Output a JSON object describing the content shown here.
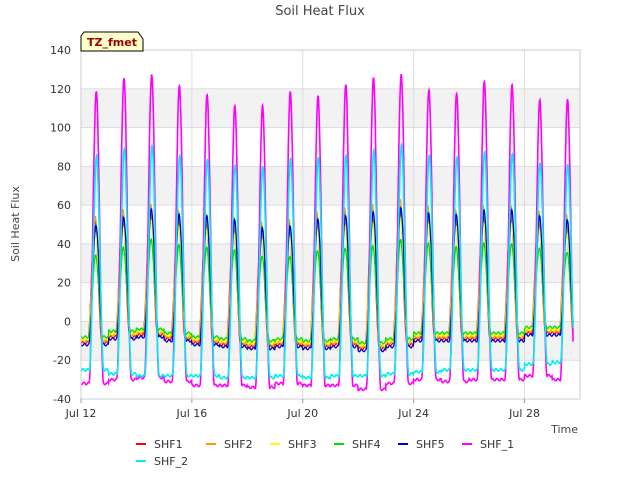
{
  "chart_data": {
    "type": "line",
    "title": "Soil Heat Flux",
    "xlabel": "Time",
    "ylabel": "Soil Heat Flux",
    "badge": "TZ_fmet",
    "x_range_days": [
      12.0,
      30.0
    ],
    "ylim": [
      -40,
      140
    ],
    "y_ticks": [
      -40,
      -20,
      0,
      20,
      40,
      60,
      80,
      100,
      120,
      140
    ],
    "x_ticks": [
      {
        "label": "Jul 12",
        "day": 12
      },
      {
        "label": "Jul 16",
        "day": 16
      },
      {
        "label": "Jul 20",
        "day": 20
      },
      {
        "label": "Jul 24",
        "day": 24
      },
      {
        "label": "Jul 28",
        "day": 28
      }
    ],
    "grid": true,
    "legend_position": "bottom",
    "series": [
      {
        "name": "SHF1",
        "color": "#ff0000",
        "peaks": [
          52,
          55,
          60,
          56,
          55,
          52,
          49,
          50,
          54,
          56,
          58,
          60,
          57,
          56,
          58,
          58,
          55,
          53
        ],
        "troughs": [
          -11,
          -8,
          -7,
          -9,
          -11,
          -12,
          -13,
          -12,
          -13,
          -12,
          -14,
          -12,
          -9,
          -9,
          -9,
          -9,
          -6,
          -6
        ]
      },
      {
        "name": "SHF2",
        "color": "#ff9900",
        "peaks": [
          54,
          58,
          61,
          58,
          56,
          54,
          51,
          52,
          56,
          58,
          60,
          63,
          60,
          58,
          60,
          60,
          57,
          55
        ],
        "troughs": [
          -10,
          -7,
          -6,
          -8,
          -10,
          -11,
          -12,
          -11,
          -12,
          -11,
          -13,
          -11,
          -8,
          -8,
          -8,
          -8,
          -5,
          -5
        ]
      },
      {
        "name": "SHF3",
        "color": "#ffff00",
        "peaks": [
          45,
          48,
          52,
          49,
          48,
          46,
          43,
          44,
          47,
          49,
          50,
          53,
          50,
          49,
          51,
          51,
          48,
          46
        ],
        "troughs": [
          -9,
          -6,
          -5,
          -7,
          -9,
          -10,
          -11,
          -10,
          -11,
          -10,
          -12,
          -10,
          -7,
          -7,
          -7,
          -7,
          -4,
          -4
        ]
      },
      {
        "name": "SHF4",
        "color": "#00dd00",
        "peaks": [
          34,
          38,
          42,
          39,
          38,
          37,
          34,
          34,
          37,
          38,
          39,
          42,
          40,
          38,
          40,
          40,
          38,
          36
        ],
        "troughs": [
          -8,
          -5,
          -4,
          -6,
          -8,
          -9,
          -10,
          -9,
          -10,
          -9,
          -11,
          -9,
          -6,
          -6,
          -6,
          -6,
          -3,
          -3
        ]
      },
      {
        "name": "SHF5",
        "color": "#0000cc",
        "peaks": [
          50,
          54,
          58,
          55,
          54,
          52,
          48,
          49,
          53,
          55,
          57,
          59,
          56,
          55,
          57,
          57,
          54,
          52
        ],
        "troughs": [
          -12,
          -9,
          -8,
          -10,
          -12,
          -13,
          -14,
          -13,
          -14,
          -13,
          -15,
          -13,
          -10,
          -10,
          -10,
          -10,
          -7,
          -7
        ]
      },
      {
        "name": "SHF_1",
        "color": "#ff00ff",
        "peaks": [
          119,
          126,
          128,
          122,
          117,
          111,
          111,
          118,
          116,
          122,
          126,
          128,
          120,
          118,
          124,
          122,
          114,
          114
        ],
        "troughs": [
          -32,
          -30,
          -29,
          -31,
          -33,
          -33,
          -34,
          -32,
          -33,
          -33,
          -35,
          -32,
          -30,
          -31,
          -30,
          -30,
          -28,
          -30
        ]
      },
      {
        "name": "SHF_2",
        "color": "#00eeee",
        "peaks": [
          85,
          89,
          91,
          86,
          84,
          81,
          80,
          84,
          84,
          85,
          88,
          91,
          86,
          85,
          88,
          87,
          82,
          81
        ],
        "troughs": [
          -25,
          -27,
          -28,
          -28,
          -28,
          -29,
          -29,
          -28,
          -29,
          -28,
          -28,
          -27,
          -26,
          -25,
          -25,
          -25,
          -22,
          -21
        ]
      }
    ]
  }
}
